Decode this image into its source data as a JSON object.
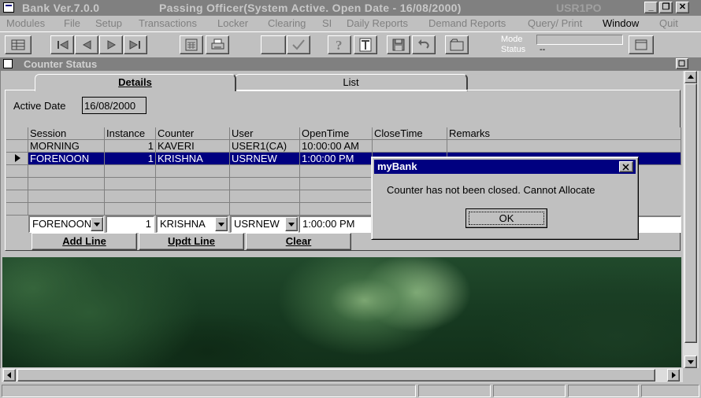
{
  "window": {
    "title": "Bank Ver.7.0.0",
    "passing": "Passing Officer(System Active. Open Date - 16/08/2000)",
    "user_id": "USR1PO",
    "controls": {
      "minimize": "_",
      "restore": "❐",
      "close": "✕"
    }
  },
  "menu": [
    "Modules",
    "File",
    "Setup",
    "Transactions",
    "Locker",
    "Clearing",
    "SI",
    "Daily Reports",
    "Demand Reports",
    "Query/ Print",
    "Window",
    "Quit"
  ],
  "toolbar": {
    "mode_label": "Mode",
    "status_label": "Status",
    "status_value": "--"
  },
  "child": {
    "title": "Counter Status",
    "tabs": [
      {
        "label": "Details"
      },
      {
        "label": "List"
      }
    ],
    "active_date_label": "Active Date",
    "active_date_value": "16/08/2000",
    "columns": [
      "Session",
      "Instance",
      "Counter",
      "User",
      "OpenTime",
      "CloseTime",
      "Remarks"
    ],
    "rows": [
      {
        "session": "MORNING",
        "instance": "1",
        "counter": "KAVERI",
        "user": "USER1(CA)",
        "open": "10:00:00 AM",
        "close": "",
        "remarks": ""
      },
      {
        "session": "FORENOON",
        "instance": "1",
        "counter": "KRISHNA",
        "user": "USRNEW",
        "open": "1:00:00 PM",
        "close": "",
        "remarks": ""
      }
    ],
    "edit": {
      "session": "FORENOON",
      "instance": "1",
      "counter": "KRISHNA",
      "user": "USRNEW",
      "open": "1:00:00 PM"
    },
    "buttons": {
      "add": "Add Line",
      "update": "Updt Line",
      "clear": "Clear"
    }
  },
  "dialog": {
    "title": "myBank",
    "message": "Counter has not been closed. Cannot Allocate",
    "ok": "OK"
  },
  "colors": {
    "selection": "#000080",
    "face": "#c0c0c0",
    "inactive_title": "#808080"
  }
}
